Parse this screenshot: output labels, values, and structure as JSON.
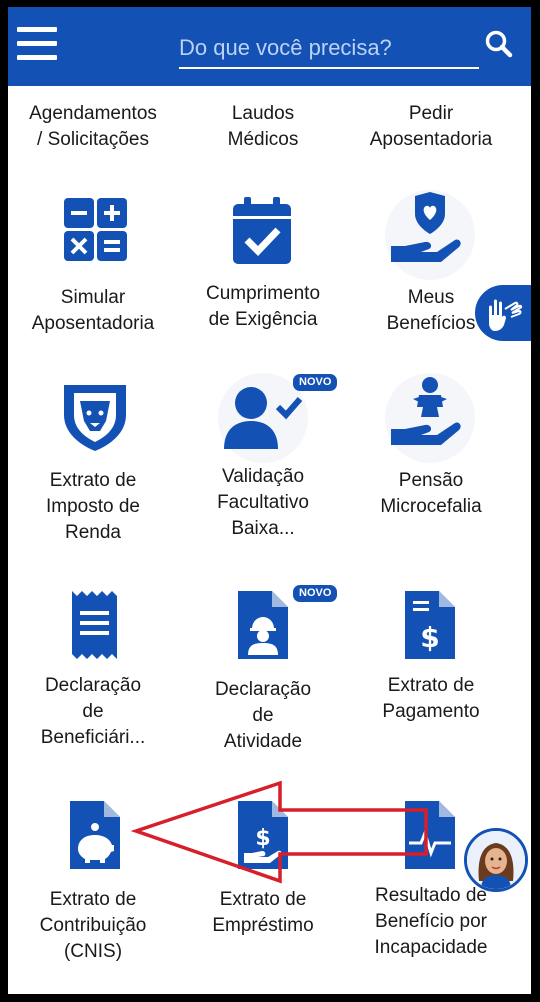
{
  "header": {
    "search_placeholder": "Do que você precisa?",
    "background": "#1351b4"
  },
  "top_row": [
    {
      "label": "Agendamentos\n/ Solicitações"
    },
    {
      "label": "Laudos\nMédicos"
    },
    {
      "label": "Pedir\nAposentadoria"
    }
  ],
  "tiles": [
    {
      "label": "Simular\nAposentadoria",
      "icon": "calculator-icon"
    },
    {
      "label": "Cumprimento\nde Exigência",
      "icon": "calendar-check-icon"
    },
    {
      "label": "Meus\nBenefícios",
      "icon": "hand-heart-shield-icon"
    },
    {
      "label": "Extrato de\nImposto de\nRenda",
      "icon": "lion-shield-icon"
    },
    {
      "label": "Validação\nFacultativo\nBaixa...",
      "icon": "user-check-icon",
      "badge": "NOVO"
    },
    {
      "label": "Pensão\nMicrocefalia",
      "icon": "hand-baby-icon"
    },
    {
      "label": "Declaração\nde\nBeneficiári...",
      "icon": "receipt-icon"
    },
    {
      "label": "Declaração\nde\nAtividade",
      "icon": "worker-document-icon",
      "badge": "NOVO"
    },
    {
      "label": "Extrato de\nPagamento",
      "icon": "dollar-document-icon"
    },
    {
      "label": "Extrato de\nContribuição\n(CNIS)",
      "icon": "piggy-bank-document-icon"
    },
    {
      "label": "Extrato de\nEmpréstimo",
      "icon": "dollar-hand-document-icon"
    },
    {
      "label": "Resultado de\nBenefício por\nIncapacidade",
      "icon": "heartbeat-document-icon"
    }
  ],
  "colors": {
    "accent": "#1351b4",
    "annotation_arrow": "#d81e2a"
  }
}
